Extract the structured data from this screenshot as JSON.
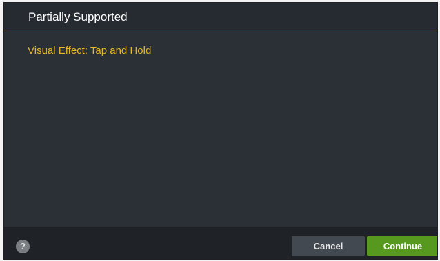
{
  "dialog": {
    "title": "Partially Supported",
    "message": "Visual Effect: Tap and Hold"
  },
  "footer": {
    "help_glyph": "?",
    "cancel_label": "Cancel",
    "continue_label": "Continue"
  },
  "colors": {
    "dialog_background": "#2b3036",
    "message_text": "#e8b625",
    "continue_button": "#57981e",
    "cancel_button": "#424951"
  },
  "icons": {
    "help": "question-circle-icon"
  }
}
